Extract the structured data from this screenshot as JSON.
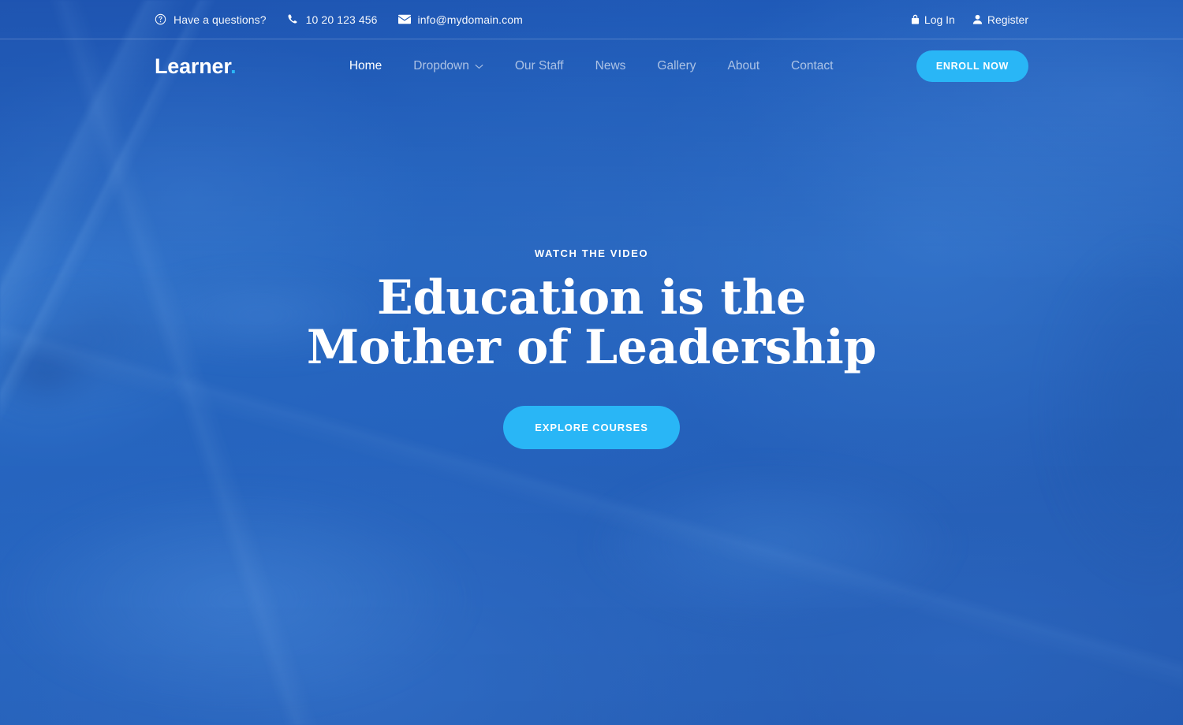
{
  "topbar": {
    "contact_items": [
      {
        "icon": "question-circle-icon",
        "label": "Have a questions?"
      },
      {
        "icon": "phone-icon",
        "label": "10 20 123 456"
      },
      {
        "icon": "envelope-icon",
        "label": "info@mydomain.com"
      }
    ],
    "account_links": [
      {
        "icon": "lock-icon",
        "label": "Log In"
      },
      {
        "icon": "user-icon",
        "label": "Register"
      }
    ]
  },
  "header": {
    "logo_text": "Learner",
    "logo_dot": ".",
    "menu": [
      {
        "label": "Home",
        "active": true,
        "has_dropdown": false
      },
      {
        "label": "Dropdown",
        "active": false,
        "has_dropdown": true
      },
      {
        "label": "Our Staff",
        "active": false,
        "has_dropdown": false
      },
      {
        "label": "News",
        "active": false,
        "has_dropdown": false
      },
      {
        "label": "Gallery",
        "active": false,
        "has_dropdown": false
      },
      {
        "label": "About",
        "active": false,
        "has_dropdown": false
      },
      {
        "label": "Contact",
        "active": false,
        "has_dropdown": false
      }
    ],
    "enroll_label": "ENROLL NOW"
  },
  "hero": {
    "eyebrow": "WATCH THE VIDEO",
    "headline": "Education is the Mother of Leadership",
    "cta_label": "EXPLORE COURSES"
  },
  "colors": {
    "accent": "#29b6f6",
    "background_blue": "#2f6fc4",
    "text_white": "#ffffff",
    "menu_inactive": "rgba(255,255,255,0.62)"
  }
}
